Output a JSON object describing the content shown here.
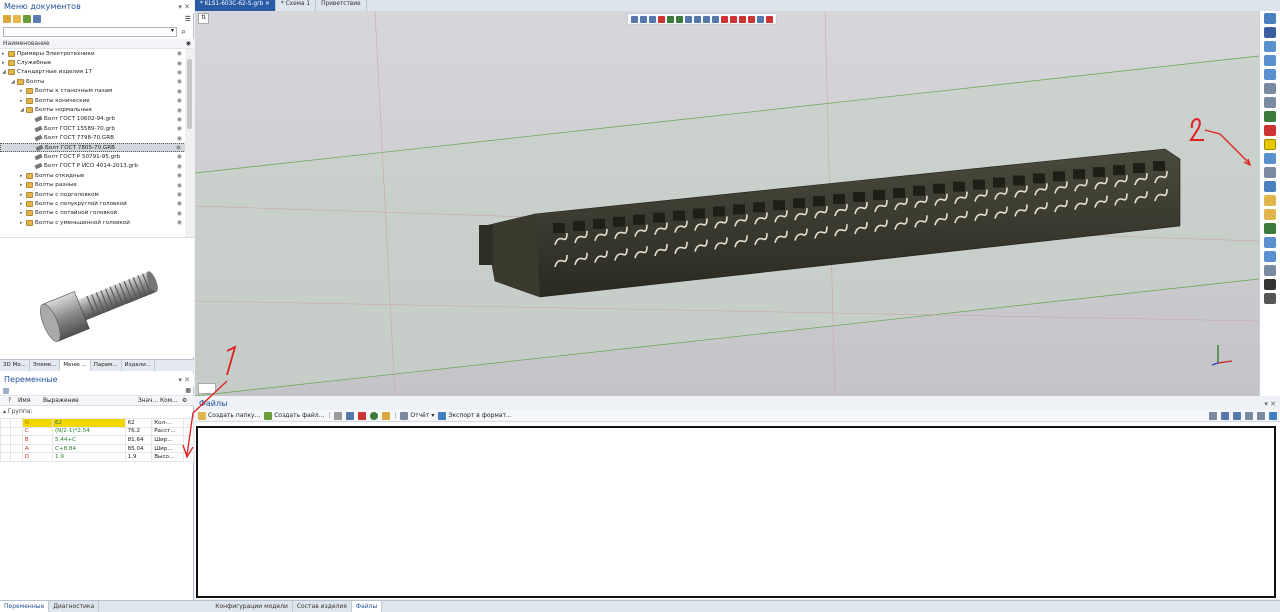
{
  "doc_menu": {
    "title": "Меню документов",
    "column": "Наименование",
    "tree": [
      {
        "label": "Примеры Электротехники",
        "level": 0,
        "type": "folder",
        "exp": "▸"
      },
      {
        "label": "Служебные",
        "level": 0,
        "type": "folder",
        "exp": "▸"
      },
      {
        "label": "Стандартные изделия 17",
        "level": 0,
        "type": "folder",
        "exp": "◢"
      },
      {
        "label": "Болты",
        "level": 1,
        "type": "folder",
        "exp": "◢"
      },
      {
        "label": "Болты к станочным пазам",
        "level": 2,
        "type": "folder",
        "exp": "▸"
      },
      {
        "label": "Болты конические",
        "level": 2,
        "type": "folder",
        "exp": "▸"
      },
      {
        "label": "Болты нормальные",
        "level": 2,
        "type": "folder",
        "exp": "◢"
      },
      {
        "label": "Болт ГОСТ 10602-94.grb",
        "level": 3,
        "type": "bolt",
        "exp": ""
      },
      {
        "label": "Болт ГОСТ 15589-70.grb",
        "level": 3,
        "type": "bolt",
        "exp": ""
      },
      {
        "label": "Болт ГОСТ 7798-70.GRB",
        "level": 3,
        "type": "bolt",
        "exp": ""
      },
      {
        "label": "Болт ГОСТ 7805-70.GRB",
        "level": 3,
        "type": "bolt",
        "exp": "",
        "selected": true
      },
      {
        "label": "Болт ГОСТ Р 50791-95.grb",
        "level": 3,
        "type": "bolt",
        "exp": ""
      },
      {
        "label": "Болт ГОСТ Р ИСО 4014-2013.grb",
        "level": 3,
        "type": "bolt",
        "exp": ""
      },
      {
        "label": "Болты откидные",
        "level": 2,
        "type": "folder",
        "exp": "▸"
      },
      {
        "label": "Болты разные",
        "level": 2,
        "type": "folder",
        "exp": "▸"
      },
      {
        "label": "Болты с подголовком",
        "level": 2,
        "type": "folder",
        "exp": "▸"
      },
      {
        "label": "Болты с полукруглой головкой",
        "level": 2,
        "type": "folder",
        "exp": "▸"
      },
      {
        "label": "Болты с потайной головкой",
        "level": 2,
        "type": "folder",
        "exp": "▸"
      },
      {
        "label": "Болты с уменьшенной головкой",
        "level": 2,
        "type": "folder",
        "exp": "▸"
      }
    ],
    "tabs": [
      "3D Мо...",
      "Элеме...",
      "Меню ...",
      "Парам...",
      "Издели..."
    ],
    "active_tab": 2
  },
  "variables": {
    "title": "Переменные",
    "headers": [
      "?",
      "Имя",
      "Выражение",
      "Знач...",
      "Ком...",
      "⚙"
    ],
    "group_label": "Группа:",
    "rows": [
      {
        "name": "N",
        "expr": "62",
        "value": "62",
        "comment": "Кол-...",
        "name_color": "#b08c00",
        "highlight": true
      },
      {
        "name": "C",
        "expr": "(N/2-1)*2.54",
        "value": "76.2",
        "comment": "Расст...",
        "name_color": "#c0392b"
      },
      {
        "name": "B",
        "expr": "5.44+C",
        "value": "81.64",
        "comment": "Шир...",
        "name_color": "#c0392b"
      },
      {
        "name": "A",
        "expr": "C+8.84",
        "value": "85.04",
        "comment": "Шир...",
        "name_color": "#c0392b"
      },
      {
        "name": "D",
        "expr": "1.9",
        "value": "1.9",
        "comment": "Высо...",
        "name_color": "#c0392b"
      }
    ]
  },
  "doc_tabs": [
    "* KLS1-603C-62-S.grb",
    "* Схема 1",
    "Приветствие"
  ],
  "files": {
    "title": "Файлы",
    "buttons": [
      "Создать папку...",
      "Создать файл...",
      "Отчёт",
      "Экспорт в формат..."
    ]
  },
  "bottom_tabs_left": [
    "Переменные",
    "Диагностика"
  ],
  "bottom_tabs_right": [
    "Конфигурации модели",
    "Состав изделия",
    "Файлы"
  ],
  "annotations": {
    "mark1": "1",
    "mark2": "2"
  },
  "colors": {
    "accent": "#2a5ca6",
    "highlight": "#f2d600",
    "annotation": "#e02020"
  }
}
